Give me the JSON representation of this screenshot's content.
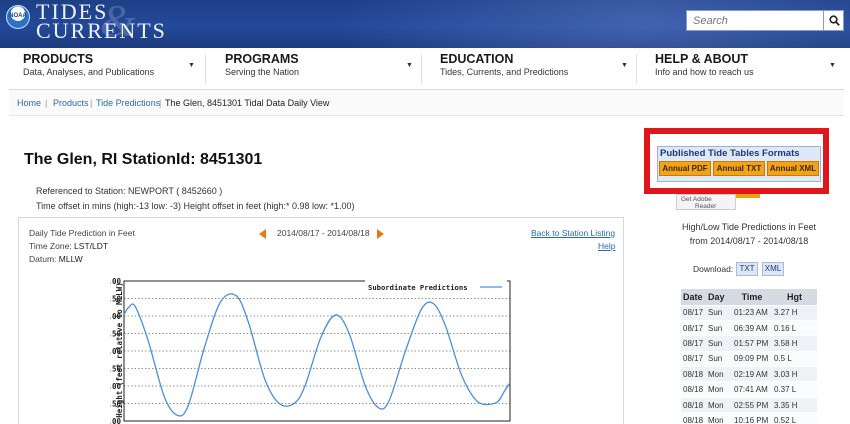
{
  "header": {
    "logo_noaa": "NOAA",
    "logo_line1": "TIDES",
    "logo_line2": "CURRENTS",
    "logo_amp": "&",
    "search_placeholder": "Search"
  },
  "nav": [
    {
      "title": "PRODUCTS",
      "subtitle": "Data, Analyses, and Publications"
    },
    {
      "title": "PROGRAMS",
      "subtitle": "Serving the Nation"
    },
    {
      "title": "EDUCATION",
      "subtitle": "Tides, Currents, and Predictions"
    },
    {
      "title": "HELP & ABOUT",
      "subtitle": "Info and how to reach us"
    }
  ],
  "breadcrumb": {
    "home": "Home",
    "products": "Products",
    "tide_predictions": "Tide Predictions",
    "current": "The Glen, 8451301 Tidal Data Daily View",
    "separator": "|"
  },
  "station": {
    "title": "The Glen, RI  StationId: 8451301",
    "reference": "Referenced to Station: NEWPORT ( 8452660 )",
    "offsets": "Time offset in mins (high:-13 low: -3)     Height offset in feet (high:* 0.98 low: *1.00)"
  },
  "panel": {
    "label_prediction": "Daily Tide Prediction in Feet",
    "label_timezone": "Time Zone: ",
    "timezone": "LST/LDT",
    "label_datum": "Datum: ",
    "datum": "MLLW",
    "date_range": "2014/08/17 - 2014/08/18",
    "back_link": "Back to Station Listing",
    "help_link": "Help"
  },
  "chart_data": {
    "type": "line",
    "title": "",
    "xlabel": "",
    "ylabel": "Height (feet relative to MLLW)",
    "ylim": [
      0,
      4
    ],
    "yticks": [
      "0.00",
      "0.50",
      "1.00",
      "1.50",
      "2.00",
      "2.50",
      "3.00",
      "3.50",
      "4.00"
    ],
    "grid": true,
    "legend_position": "top-right",
    "series": [
      {
        "name": "Subordinate Predictions",
        "color": "#4a90d9",
        "points": [
          {
            "t": 0.0,
            "h": 3.05
          },
          {
            "t": 0.6,
            "h": 3.25
          },
          {
            "t": 1.4,
            "h": 3.27
          },
          {
            "t": 3.0,
            "h": 2.3
          },
          {
            "t": 5.0,
            "h": 0.7
          },
          {
            "t": 6.65,
            "h": 0.16
          },
          {
            "t": 8.0,
            "h": 0.45
          },
          {
            "t": 10.0,
            "h": 2.1
          },
          {
            "t": 12.0,
            "h": 3.4
          },
          {
            "t": 13.95,
            "h": 3.58
          },
          {
            "t": 15.5,
            "h": 2.8
          },
          {
            "t": 17.5,
            "h": 1.2
          },
          {
            "t": 19.3,
            "h": 0.5
          },
          {
            "t": 21.15,
            "h": 0.5
          },
          {
            "t": 22.5,
            "h": 1.0
          },
          {
            "t": 24.5,
            "h": 2.4
          },
          {
            "t": 26.33,
            "h": 3.03
          },
          {
            "t": 28.0,
            "h": 2.5
          },
          {
            "t": 30.0,
            "h": 1.0
          },
          {
            "t": 31.7,
            "h": 0.37
          },
          {
            "t": 33.0,
            "h": 0.6
          },
          {
            "t": 35.0,
            "h": 2.0
          },
          {
            "t": 37.0,
            "h": 3.2
          },
          {
            "t": 38.5,
            "h": 3.35
          },
          {
            "t": 40.0,
            "h": 2.7
          },
          {
            "t": 42.0,
            "h": 1.3
          },
          {
            "t": 44.0,
            "h": 0.55
          },
          {
            "t": 46.25,
            "h": 0.52
          },
          {
            "t": 47.3,
            "h": 0.85
          },
          {
            "t": 48.0,
            "h": 1.1
          }
        ]
      }
    ]
  },
  "tide_tables": {
    "title": "Published Tide Tables Formats",
    "buttons": [
      "Annual PDF",
      "Annual TXT",
      "Annual XML"
    ],
    "adobe_get": "Get Adobe",
    "adobe_reader": "Reader"
  },
  "highlow": {
    "title_line1": "High/Low Tide Predictions in Feet",
    "title_line2": "from 2014/08/17 - 2014/08/18",
    "download_label": "Download:",
    "download_txt": "TXT",
    "download_xml": "XML",
    "columns": [
      "Date",
      "Day",
      "Time",
      "Hgt"
    ],
    "rows": [
      [
        "08/17",
        "Sun",
        "01:23 AM",
        "3.27 H"
      ],
      [
        "08/17",
        "Sun",
        "06:39 AM",
        "0.16 L"
      ],
      [
        "08/17",
        "Sun",
        "01:57 PM",
        "3.58 H"
      ],
      [
        "08/17",
        "Sun",
        "09:09 PM",
        "0.5 L"
      ],
      [
        "08/18",
        "Mon",
        "02:19 AM",
        "3.03 H"
      ],
      [
        "08/18",
        "Mon",
        "07:41 AM",
        "0.37 L"
      ],
      [
        "08/18",
        "Mon",
        "02:55 PM",
        "3.35 H"
      ],
      [
        "08/18",
        "Mon",
        "10:16 PM",
        "0.52 L"
      ]
    ]
  }
}
